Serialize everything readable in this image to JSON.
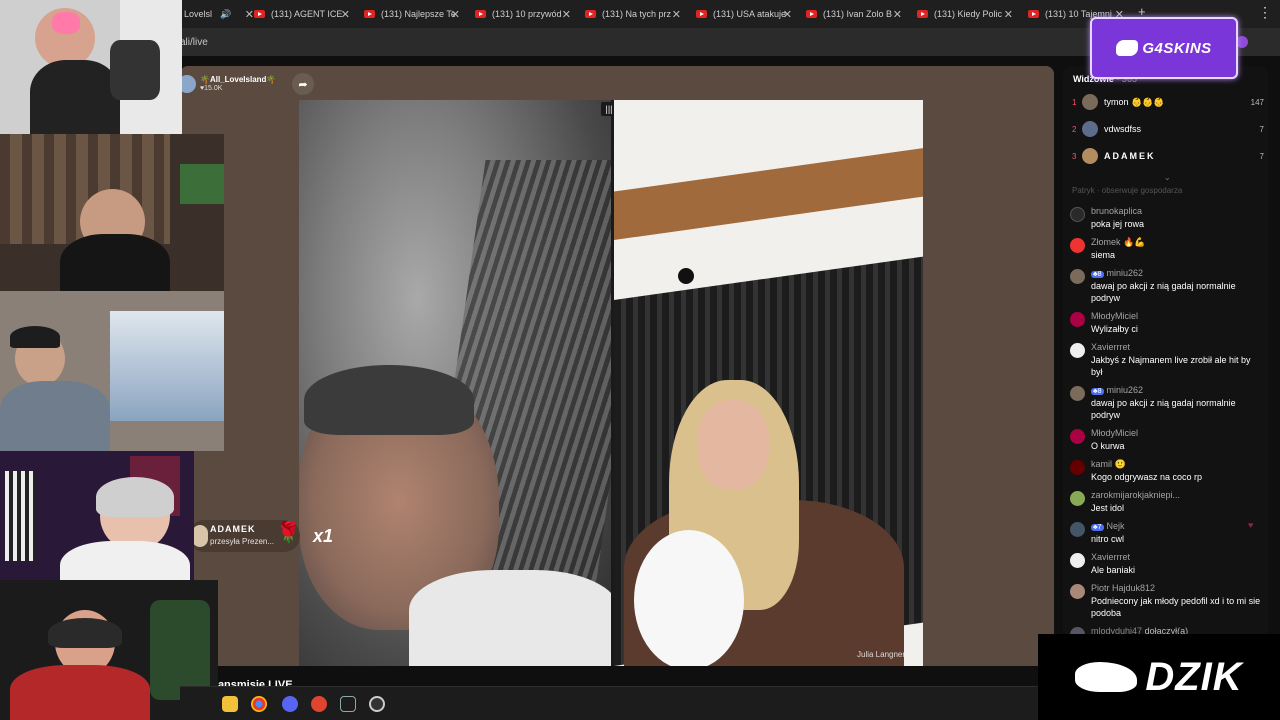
{
  "browser": {
    "tabs": [
      {
        "title": "Lovelsl",
        "active": true
      },
      {
        "title": "(131) AGENT ICE"
      },
      {
        "title": "(131) Najlepsze Te"
      },
      {
        "title": "(131) 10 przywód"
      },
      {
        "title": "(131) Na tych prz"
      },
      {
        "title": "(131) USA atakuje"
      },
      {
        "title": "(131) Ivan Zolo B"
      },
      {
        "title": "(131) Kiedy Polic"
      },
      {
        "title": "(131) 10 Tajemni"
      }
    ],
    "url": "ali/live"
  },
  "live": {
    "host_name": "🌴All_LoveIsland🌴",
    "host_likes": "♥15.0K",
    "guest_name": "Julia Langner",
    "gift_sender": "ADAMEK",
    "gift_action": "przesyła Prezen...",
    "gift_count": "x1",
    "caption": "transmisie LIVE"
  },
  "chat": {
    "viewers_label": "Widzowie",
    "viewers_count": "· 365",
    "ranking": [
      {
        "rank": "1",
        "name": "tymon 👶👶👶",
        "score": "147",
        "color": "#7a6a5a"
      },
      {
        "rank": "2",
        "name": "vdwsdfss",
        "score": "7",
        "color": "#5c6c8a"
      },
      {
        "rank": "3",
        "name": "ADAMEK",
        "score": "7",
        "color": "#b38c5f"
      }
    ],
    "system_line": "Patryk · obserwuje gospodarza",
    "messages": [
      {
        "user": "brunokaplica",
        "text": "poka jej rowa",
        "color": "#2a2a2a"
      },
      {
        "user": "Złomek 🔥💪",
        "text": "siema",
        "color": "#e33"
      },
      {
        "user": "miniu262",
        "badge": "8",
        "text": "dawaj po akcji z nią gadaj normalnie podryw",
        "color": "#7a6b5a"
      },
      {
        "user": "MłodyMiciel",
        "text": "Wylizałby ci",
        "color": "#a04"
      },
      {
        "user": "Xavierrret",
        "text": "Jakbyś z Najmanem live zrobił ale hit by był",
        "color": "#eee"
      },
      {
        "user": "miniu262",
        "badge": "8",
        "text": "dawaj po akcji z nią gadaj normalnie podryw",
        "color": "#7a6b5a"
      },
      {
        "user": "MłodyMiciel",
        "text": "O kurwa",
        "color": "#a04"
      },
      {
        "user": "kamil 🙂",
        "text": "Kogo odgrywasz na coco rp",
        "color": "#600"
      },
      {
        "user": "zarokmijarokjakniepi...",
        "text": "Jest idol",
        "color": "#8a5"
      },
      {
        "user": "Nejk",
        "badge": "7",
        "text": "nitro cwl",
        "color": "#456"
      },
      {
        "user": "Xavierrret",
        "text": "Ale baniaki",
        "color": "#eee"
      },
      {
        "user": "Piotr Hajduk812",
        "text": "Podniecony jak młody pedofil xd i to mi sie podoba",
        "color": "#a87"
      },
      {
        "user": "mlodyduhi47",
        "text": "dołączył(a)",
        "color": "#556"
      }
    ]
  },
  "overlays": {
    "sponsor": "G4SKINS",
    "brand": "DZIK"
  },
  "colors": {
    "accent_red": "#ff4d6d",
    "sponsor_purple": "#7a36d8",
    "stage_bg": "#5a4a3f"
  }
}
